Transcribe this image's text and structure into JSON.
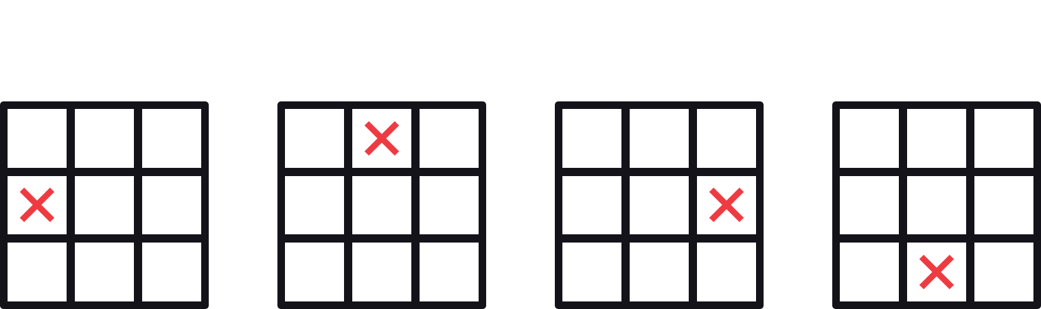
{
  "boards": [
    {
      "marked_cell": {
        "row": 1,
        "col": 0
      },
      "mark_symbol": "x-icon"
    },
    {
      "marked_cell": {
        "row": 0,
        "col": 1
      },
      "mark_symbol": "x-icon"
    },
    {
      "marked_cell": {
        "row": 1,
        "col": 2
      },
      "mark_symbol": "x-icon"
    },
    {
      "marked_cell": {
        "row": 2,
        "col": 1
      },
      "mark_symbol": "x-icon"
    }
  ],
  "grid_size": 3,
  "colors": {
    "grid_line": "#14131a",
    "cell_background": "#ffffff",
    "mark": "#ee3b42"
  }
}
